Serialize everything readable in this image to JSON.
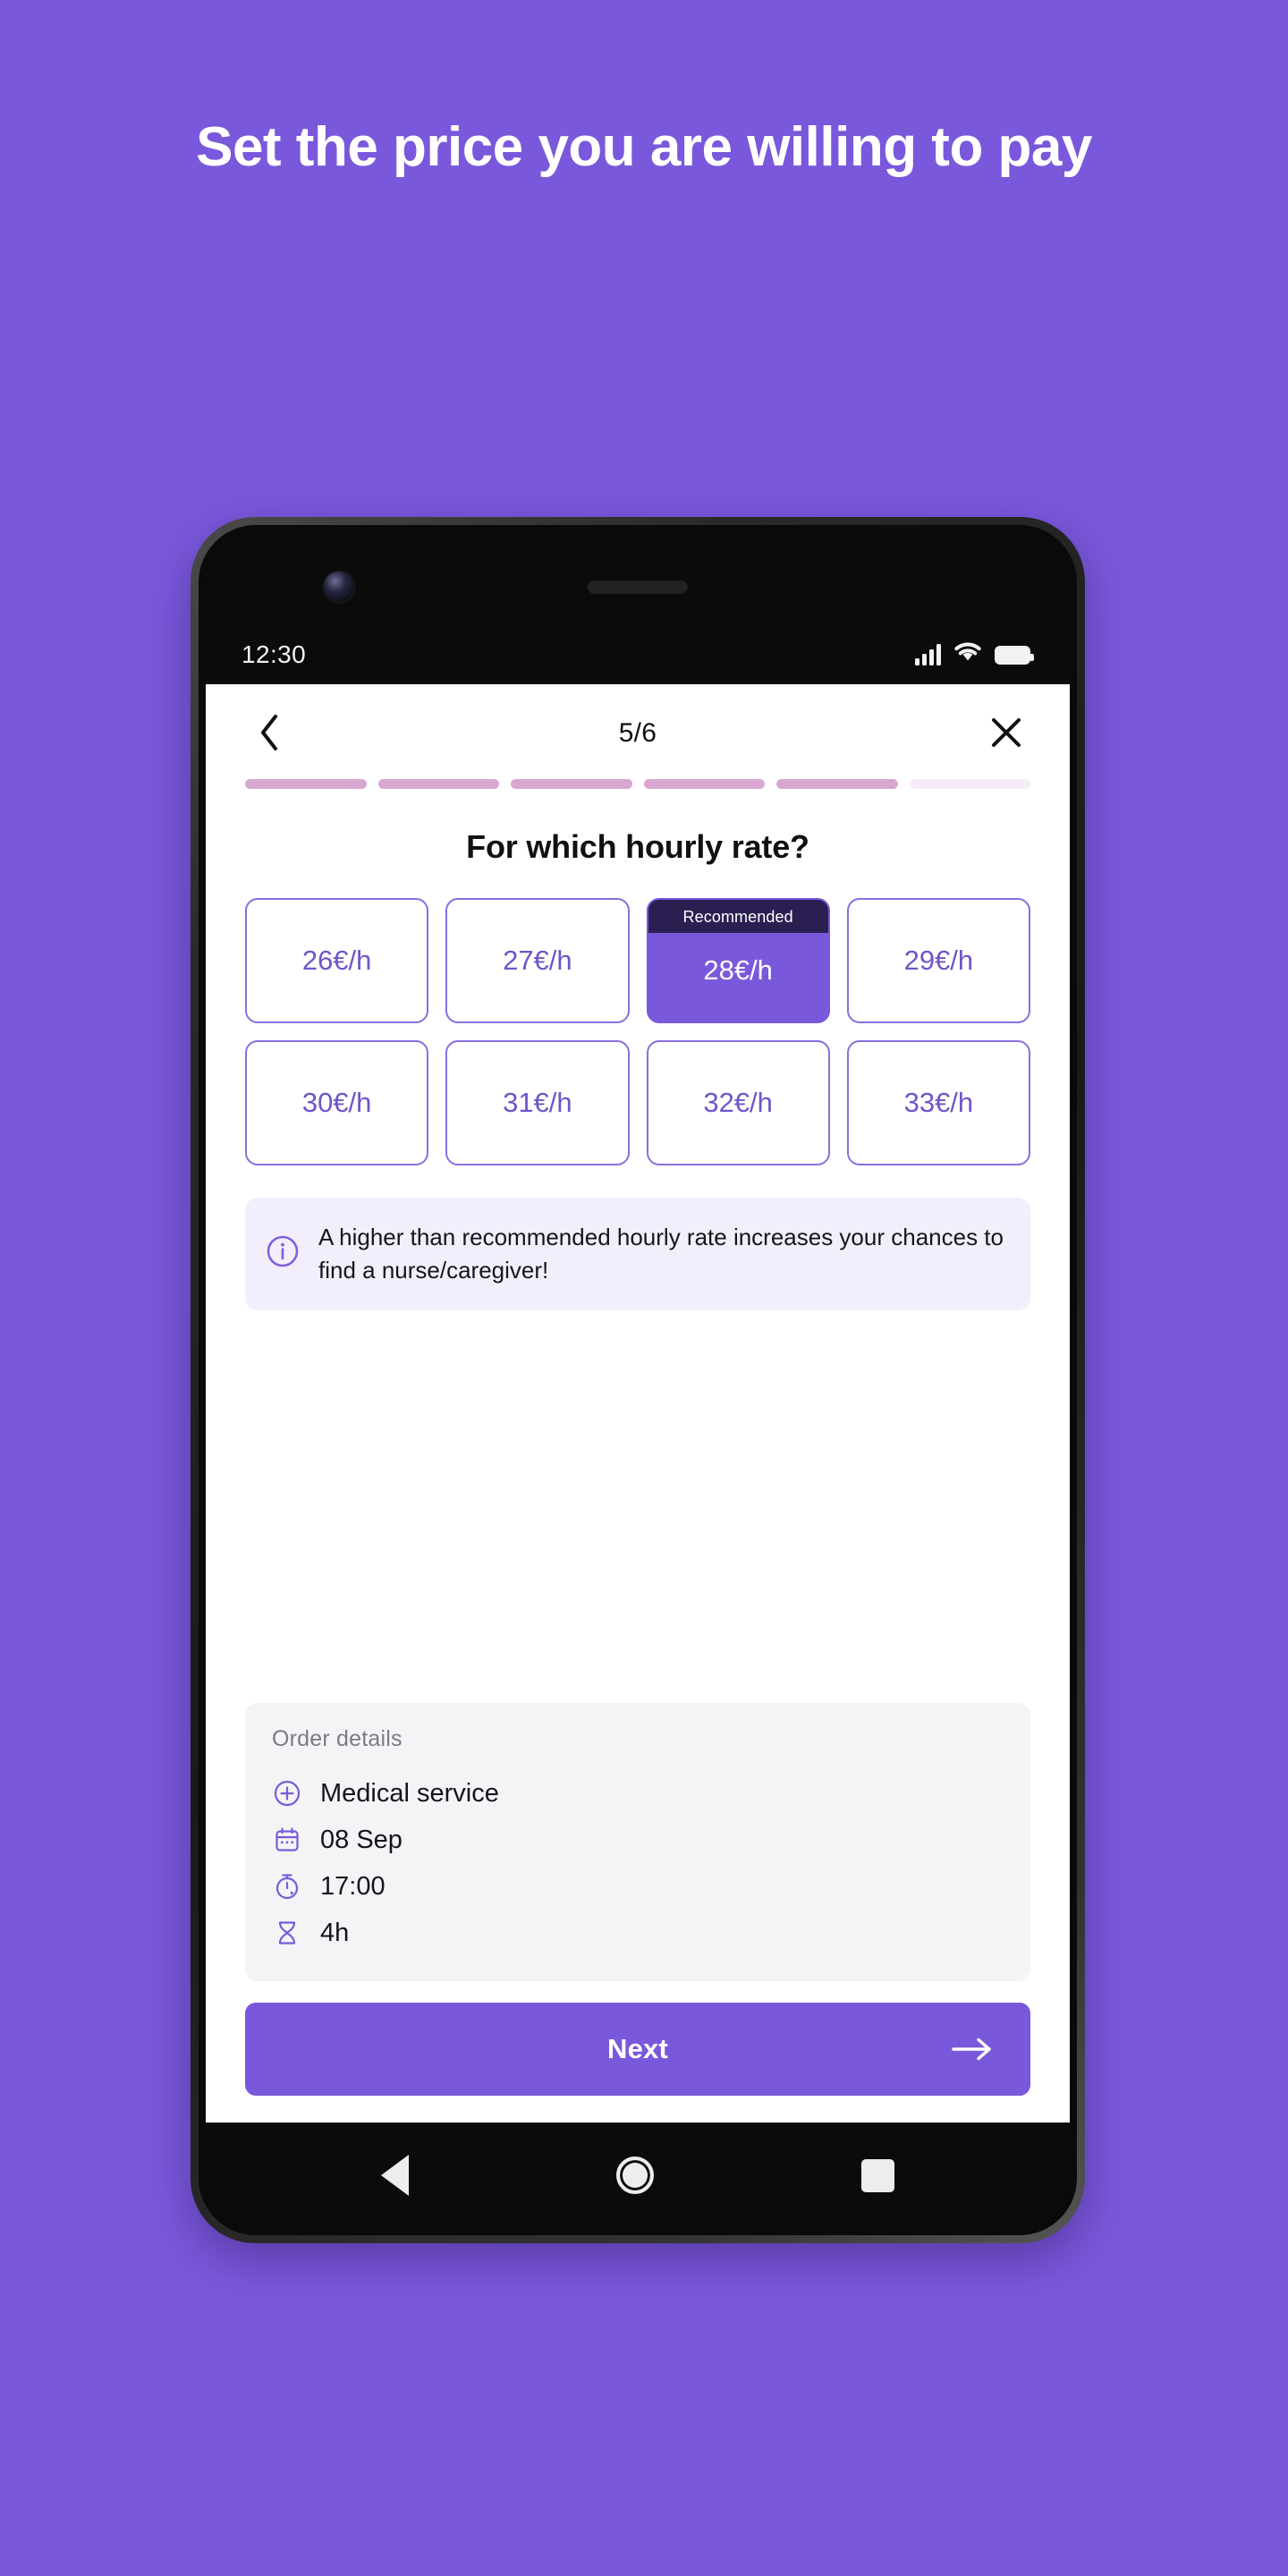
{
  "promo": {
    "headline": "Set the price you are willing to pay",
    "background_color": "#7a58db"
  },
  "status_bar": {
    "time": "12:30",
    "signal_icon": "cellular-signal-icon",
    "wifi_icon": "wifi-icon",
    "battery_icon": "battery-full-icon"
  },
  "app": {
    "header": {
      "back_icon": "chevron-left-icon",
      "step_counter": "5/6",
      "close_icon": "close-x-icon"
    },
    "progress": {
      "total_steps": 6,
      "completed_steps": 5,
      "filled_color": "#d7a7d2",
      "empty_color": "#f5ecf6"
    },
    "question": "For which hourly rate?",
    "rates": [
      {
        "label": "26€/h",
        "selected": false,
        "badge": ""
      },
      {
        "label": "27€/h",
        "selected": false,
        "badge": ""
      },
      {
        "label": "28€/h",
        "selected": true,
        "badge": "Recommended"
      },
      {
        "label": "29€/h",
        "selected": false,
        "badge": ""
      },
      {
        "label": "30€/h",
        "selected": false,
        "badge": ""
      },
      {
        "label": "31€/h",
        "selected": false,
        "badge": ""
      },
      {
        "label": "32€/h",
        "selected": false,
        "badge": ""
      },
      {
        "label": "33€/h",
        "selected": false,
        "badge": ""
      }
    ],
    "info_callout": {
      "icon": "info-circle-icon",
      "text": "A higher than recommended hourly rate increases your chances to find a nurse/caregiver!"
    },
    "order_details": {
      "heading": "Order details",
      "rows": [
        {
          "icon": "plus-circle-icon",
          "text": "Medical service"
        },
        {
          "icon": "calendar-icon",
          "text": "08 Sep"
        },
        {
          "icon": "stopwatch-icon",
          "text": "17:00"
        },
        {
          "icon": "hourglass-icon",
          "text": "4h"
        }
      ]
    },
    "next_button": {
      "label": "Next",
      "arrow_icon": "arrow-right-icon",
      "color": "#7a58db"
    }
  },
  "android_nav": {
    "back_icon": "nav-back-triangle-icon",
    "home_icon": "nav-home-circle-icon",
    "recents_icon": "nav-recents-square-icon"
  }
}
